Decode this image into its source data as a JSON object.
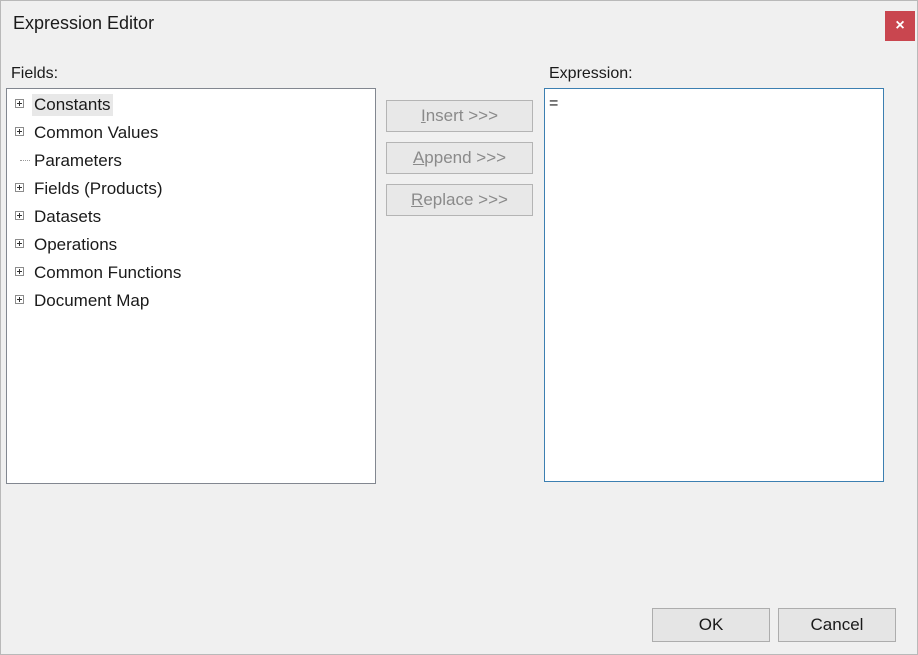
{
  "window": {
    "title": "Expression Editor",
    "close_label": "×"
  },
  "fields": {
    "label": "Fields:",
    "items": [
      {
        "label": "Constants",
        "expandable": true,
        "selected": true
      },
      {
        "label": "Common Values",
        "expandable": true
      },
      {
        "label": "Parameters",
        "expandable": false
      },
      {
        "label": "Fields (Products)",
        "expandable": true
      },
      {
        "label": "Datasets",
        "expandable": true
      },
      {
        "label": "Operations",
        "expandable": true
      },
      {
        "label": "Common Functions",
        "expandable": true
      },
      {
        "label": "Document Map",
        "expandable": true
      }
    ]
  },
  "actions": {
    "insert": {
      "mnemonic": "I",
      "rest": "nsert >>>"
    },
    "append": {
      "mnemonic": "A",
      "rest": "ppend >>>"
    },
    "replace": {
      "mnemonic": "R",
      "rest": "eplace >>>"
    }
  },
  "expression": {
    "label": "Expression:",
    "value": "="
  },
  "footer": {
    "ok_label": "OK",
    "cancel_label": "Cancel"
  }
}
